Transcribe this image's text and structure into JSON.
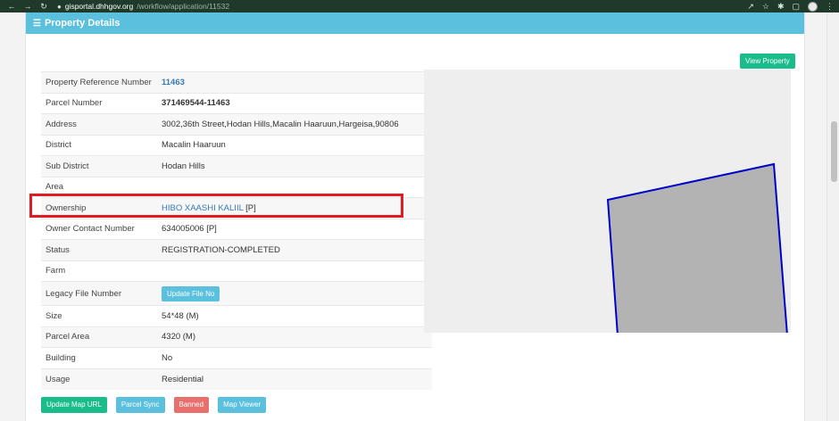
{
  "browser": {
    "url_host": "gisportal.dhhgov.org",
    "url_path": "/workflow/application/11532"
  },
  "card": {
    "title": "Property Details"
  },
  "details": [
    {
      "label": "Property Reference Number",
      "value": "11463"
    },
    {
      "label": "Parcel Number",
      "value": "371469544-11463"
    },
    {
      "label": "Address",
      "value": "3002,36th Street,Hodan Hills,Macalin Haaruun,Hargeisa,90806"
    },
    {
      "label": "District",
      "value": "Macalin Haaruun"
    },
    {
      "label": "Sub District",
      "value": "Hodan Hills"
    },
    {
      "label": "Area",
      "value": ""
    },
    {
      "label": "Ownership",
      "value": "HIBO XAASHI KALIIL",
      "suffix": " [P]"
    },
    {
      "label": "Owner Contact Number",
      "value": "634005006 [P]"
    },
    {
      "label": "Status",
      "value": "REGISTRATION-COMPLETED"
    },
    {
      "label": "Farm",
      "value": ""
    },
    {
      "label": "Legacy File Number",
      "button": "Update File No"
    },
    {
      "label": "Size",
      "value": "54*48 (M)"
    },
    {
      "label": "Parcel Area",
      "value": "4320 (M)"
    },
    {
      "label": "Building",
      "value": "No"
    },
    {
      "label": "Usage",
      "value": "Residential"
    }
  ],
  "buttons": {
    "update_map_url": "Update Map URL",
    "parcel_sync": "Parcel Sync",
    "banned": "Banned",
    "map_viewer": "Map Viewer",
    "view_property": "View Property"
  },
  "colors": {
    "header": "#5bc0de",
    "highlight": "#e11b22",
    "parcel_fill": "#b3b3b3",
    "parcel_stroke": "#0000cc"
  }
}
